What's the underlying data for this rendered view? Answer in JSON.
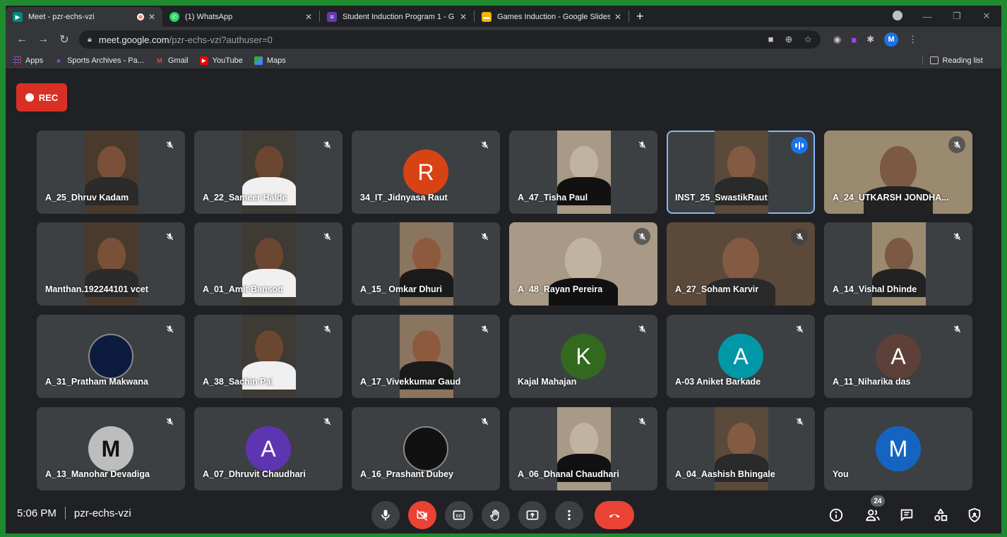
{
  "browser": {
    "tabs": [
      {
        "title": "Meet - pzr-echs-vzi",
        "favicon": "meet-icon",
        "color": "#00897b"
      },
      {
        "title": "(1) WhatsApp",
        "favicon": "whatsapp-icon",
        "color": "#25d366"
      },
      {
        "title": "Student Induction Program 1 - G",
        "favicon": "forms-icon",
        "color": "#673ab7"
      },
      {
        "title": "Games Induction - Google Slides",
        "favicon": "slides-icon",
        "color": "#f4b400"
      }
    ],
    "url_host": "meet.google.com",
    "url_path": "/pzr-echs-vzi?authuser=0",
    "profile_initial": "M",
    "bookmarks": [
      {
        "label": "Apps",
        "icon": "apps-grid-icon",
        "color": "#4285f4"
      },
      {
        "label": "Sports Archives - Pa...",
        "icon": "sports-icon",
        "color": "#7e57c2"
      },
      {
        "label": "Gmail",
        "icon": "gmail-icon",
        "color": "#ea4335"
      },
      {
        "label": "YouTube",
        "icon": "youtube-icon",
        "color": "#ff0000"
      },
      {
        "label": "Maps",
        "icon": "maps-icon",
        "color": "#34a853"
      }
    ],
    "reading_list": "Reading list"
  },
  "meet": {
    "rec_label": "REC",
    "time": "5:06 PM",
    "meeting_code": "pzr-echs-vzi",
    "participant_count": "24",
    "participants": [
      {
        "name": "A_25_Dhruv Kadam",
        "kind": "video"
      },
      {
        "name": "A_22_Sameer Halde",
        "kind": "video"
      },
      {
        "name": "34_IT_Jidnyasa Raut",
        "kind": "initial",
        "initial": "R",
        "color": "#d84315"
      },
      {
        "name": "A_47_Tisha Paul",
        "kind": "video"
      },
      {
        "name": "INST_25_SwastikRaut",
        "kind": "video",
        "speaking": true
      },
      {
        "name": "A_24_UTKARSH JONDHA...",
        "kind": "video-wide"
      },
      {
        "name": "Manthan.192244101 vcet",
        "kind": "video"
      },
      {
        "name": "A_01_Amit Bansod",
        "kind": "video"
      },
      {
        "name": "A_15_ Omkar Dhuri",
        "kind": "video"
      },
      {
        "name": "A_48_Rayan Pereira",
        "kind": "video-wide"
      },
      {
        "name": "A_27_Soham Karvir",
        "kind": "video-wide"
      },
      {
        "name": "A_14_Vishal Dhinde",
        "kind": "video"
      },
      {
        "name": "A_31_Pratham Makwana",
        "kind": "image",
        "color": "#0d1b3e"
      },
      {
        "name": "A_38_Sachin Pal",
        "kind": "video"
      },
      {
        "name": "A_17_Vivekkumar Gaud",
        "kind": "video"
      },
      {
        "name": "Kajal Mahajan",
        "kind": "initial",
        "initial": "K",
        "color": "#33691e"
      },
      {
        "name": "A-03 Aniket Barkade",
        "kind": "initial",
        "initial": "A",
        "color": "#0097a7"
      },
      {
        "name": "A_11_Niharika das",
        "kind": "initial",
        "initial": "A",
        "color": "#5d4037"
      },
      {
        "name": "A_13_Manohar Devadiga",
        "kind": "image-m",
        "initial": "M",
        "color": "#bdbdbd"
      },
      {
        "name": "A_07_Dhruvit Chaudhari",
        "kind": "initial",
        "initial": "A",
        "color": "#5e35b1"
      },
      {
        "name": "A_16_Prashant Dubey",
        "kind": "image",
        "color": "#111111"
      },
      {
        "name": "A_06_Dhanal Chaudhari",
        "kind": "video"
      },
      {
        "name": "A_04_Aashish Bhingale",
        "kind": "video"
      },
      {
        "name": "You",
        "kind": "initial",
        "initial": "M",
        "color": "#1565c0",
        "self": true
      }
    ],
    "controls": [
      "mic-icon",
      "camera-off-icon",
      "captions-icon",
      "raise-hand-icon",
      "present-icon",
      "more-options-icon",
      "hang-up-icon"
    ],
    "right_controls": [
      "info-icon",
      "people-icon",
      "chat-icon",
      "activities-icon",
      "host-controls-icon"
    ]
  }
}
